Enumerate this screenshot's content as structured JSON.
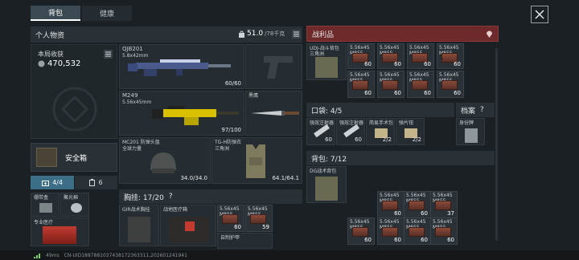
{
  "tabs": {
    "backpack": "背包",
    "health": "健康"
  },
  "personal": {
    "title": "个人物资",
    "capacity": "51.0",
    "capacity_max": "/78千克"
  },
  "earnings": {
    "label": "本局收获",
    "value": "470,532"
  },
  "safebox": {
    "label": "安全箱"
  },
  "counters": {
    "first": "4/4",
    "second": "6"
  },
  "weapons": [
    {
      "name": "QJB201",
      "sub": "5.8x42mm",
      "count": "60/60"
    },
    {
      "name": "M249",
      "sub": "5.56x45mm",
      "count": "97/100"
    },
    {
      "name": "黑鹰",
      "sub": "",
      "count": ""
    },
    {
      "name": "MC201 防弹头盔",
      "sub": "全球力量",
      "count": "34.0/34.0"
    },
    {
      "name": "TG-H防弹衣",
      "sub": "三角洲",
      "count": "64.1/64.1"
    }
  ],
  "small_items": [
    {
      "name": "绷带盒",
      "sub": ""
    },
    {
      "name": "聚光棉",
      "sub": ""
    },
    {
      "name": "专业医疗",
      "sub": ""
    }
  ],
  "chest": {
    "title": "胸挂:  17/20",
    "help": "?"
  },
  "chest_items": [
    {
      "name": "GIR战术胸挂",
      "count": ""
    },
    {
      "name": "战地医疗箱",
      "count": ""
    },
    {
      "name": "5.56x45\nM855",
      "count": "60"
    },
    {
      "name": "5.56x45\nM855",
      "count": "59"
    },
    {
      "name": "自制护甲",
      "count": ""
    }
  ],
  "loot": {
    "title": "战利品"
  },
  "loot_bag": {
    "name": "UDJ-战斗背包",
    "sub": "三角洲"
  },
  "pocket": {
    "title": "口袋:  4/5"
  },
  "pocket_items": [
    {
      "name": "强效注射器",
      "count": "60"
    },
    {
      "name": "强效注射器",
      "count": "60"
    },
    {
      "name": "简易手术包",
      "count": "2/2"
    },
    {
      "name": "弹片钳",
      "count": "2/2"
    }
  ],
  "archive": {
    "title": "档案",
    "help": "?",
    "item": "身份牌"
  },
  "backpack2": {
    "title": "背包:  7/12",
    "bag": "DG战术背包"
  },
  "ammo_label": "5.56x45\nM855",
  "ammo_top": [
    "60",
    "60",
    "60",
    "60",
    "60",
    "60",
    "60",
    "60",
    "60"
  ],
  "ammo_bottom": [
    "60",
    "60",
    "37",
    "60",
    "60",
    "60",
    "60",
    "60",
    "60",
    "60"
  ],
  "status": {
    "ping": "49ms",
    "uid": "CN-UID1887881037438172363311,202601241941"
  },
  "colors": {
    "loot_header": "#6e2a2a",
    "accent": "#3c6e87",
    "weapon_yellow": "#d8c200"
  }
}
